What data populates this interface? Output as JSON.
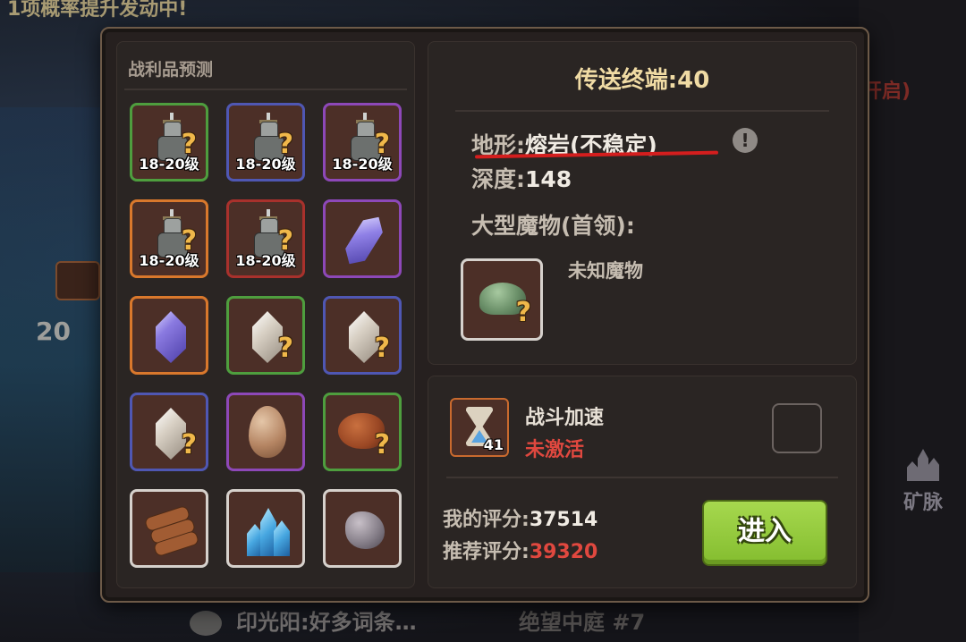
{
  "background": {
    "top_banner": "1项概率提升发动中!",
    "right_red_text": "开启)",
    "vein_label": "矿脉",
    "chat_message": "印光阳:好多词条…",
    "bottom_location": "绝望中庭 #7",
    "left_number": "20"
  },
  "loot": {
    "title": "战利品预测",
    "items": [
      {
        "rarity": "green",
        "icon": "knight-armor-icon",
        "level": "18-20级",
        "unknown": true
      },
      {
        "rarity": "blue",
        "icon": "knight-armor-icon",
        "level": "18-20级",
        "unknown": true
      },
      {
        "rarity": "purple",
        "icon": "knight-armor-icon",
        "level": "18-20级",
        "unknown": true
      },
      {
        "rarity": "orange",
        "icon": "knight-armor-icon",
        "level": "18-20级",
        "unknown": true
      },
      {
        "rarity": "red",
        "icon": "knight-armor-icon",
        "level": "18-20级",
        "unknown": true
      },
      {
        "rarity": "purple",
        "icon": "violet-shard-icon",
        "level": "",
        "unknown": false
      },
      {
        "rarity": "orange",
        "icon": "violet-crystal-icon",
        "level": "",
        "unknown": false
      },
      {
        "rarity": "green",
        "icon": "pale-crystal-icon",
        "level": "",
        "unknown": true
      },
      {
        "rarity": "blue",
        "icon": "pale-crystal-icon",
        "level": "",
        "unknown": true
      },
      {
        "rarity": "blue",
        "icon": "pale-crystal-icon",
        "level": "",
        "unknown": true
      },
      {
        "rarity": "purple",
        "icon": "egg-icon",
        "level": "",
        "unknown": false
      },
      {
        "rarity": "green",
        "icon": "roast-chicken-icon",
        "level": "",
        "unknown": true
      },
      {
        "rarity": "white",
        "icon": "wood-logs-icon",
        "level": "",
        "unknown": false
      },
      {
        "rarity": "white",
        "icon": "blue-crystal-cluster-icon",
        "level": "",
        "unknown": false
      },
      {
        "rarity": "white",
        "icon": "ore-stone-icon",
        "level": "",
        "unknown": false
      }
    ],
    "unknown_mark": "?"
  },
  "info": {
    "portal_title": "传送终端:40",
    "terrain_label": "地形:",
    "terrain_value": "熔岩(不稳定)",
    "depth_label": "深度:",
    "depth_value": "148",
    "boss_label": "大型魔物(首领):",
    "boss_name": "未知魔物",
    "boss_unknown_mark": "?",
    "alert_mark": "!"
  },
  "boost": {
    "name": "战斗加速",
    "status": "未激活",
    "count": "41"
  },
  "scores": {
    "my_label": "我的评分:",
    "my_value": "37514",
    "rec_label": "推荐评分:",
    "rec_value": "39320"
  },
  "enter_button": "进入",
  "colors": {
    "rarity_green": "#4e9e3e",
    "rarity_blue": "#4f57b3",
    "rarity_purple": "#8d48b8",
    "rarity_orange": "#d9782c",
    "rarity_red": "#a8312c",
    "warning_red": "#e0483f",
    "enter_green": "#9ccf45"
  }
}
